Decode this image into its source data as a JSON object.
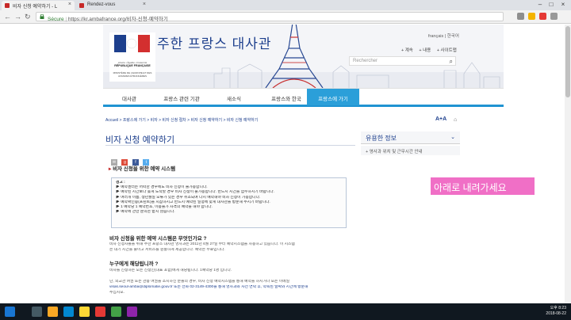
{
  "browser": {
    "tabs": [
      {
        "label": "비자 신청 예약하기 - L"
      },
      {
        "label": "Rendez-vous"
      }
    ],
    "secure_label": "Sécure",
    "url": "https://kr.ambafrance.org/비자-신청-예약하기"
  },
  "header": {
    "site_title": "주한 프랑스 대사관",
    "logo_caption": "Liberté • Égalité • Fraternité",
    "logo_republic": "RÉPUBLIQUE FRANÇAISE",
    "logo_ministry": "MINISTÈRE DE L'EUROPE ET DES AFFAIRES ÉTRANGÈRES",
    "lang_links": "français | 한국어",
    "top_links": [
      "+ 계속",
      "+ 내용",
      "+ 사이트맵"
    ],
    "search_placeholder": "Rechercher"
  },
  "nav": {
    "items": [
      {
        "label": "대사관"
      },
      {
        "label": "프랑스 관련 기관"
      },
      {
        "label": "새소식"
      },
      {
        "label": "프랑스와 한국"
      },
      {
        "label": "프랑스에 가기"
      }
    ]
  },
  "breadcrumb": "Accueil > 프랑스에 가기 > 비자 > 비자 신청 절차 > 비자 신청 예약하기 > 비자 신청 예약하기",
  "font_control": "A+A",
  "main": {
    "title": "비자 신청 예약하기",
    "share_buttons": [
      "mail",
      "g+",
      "f",
      "t"
    ],
    "section_heading": "비자 신청을 위한 예약 시스템",
    "notice_lines": [
      "경고 :",
      "▶ 예약센터는 어떠한 경우에도 비자 신청이 불가능합니다.",
      "▶ 예약된 시간보다 늦게 도착할 경우 비자 신청이 불가능합니다. 반드시 시간을 엄수하시기 바랍니다.",
      "▶ 여러개 이름, 생년월일 오류가 있는 경우 취소되며 다시 예약해야 비자 신청이 가능합니다.",
      "▶ 예약확인증(프린트)을 지참하시고 반드시 예약된 일정에 맞게 대사관을 방문해 주시기 바랍니다.",
      "▶ 1 예약당 1 예약번호, 이용불가 자격의 예약을 해야 합니다.",
      "▶ 예약에 관한 문의는 받지 않습니다."
    ],
    "q1": "비자 신청을 위한 예약 시스템은 무엇인가요 ?",
    "p1": [
      "비자 신청자들을 위해 주한 프랑스 대사관 영사과는 2011년 6월 27일 부터 예약시스템을 사용하고 있습니다. 이 시스템",
      "은 대기 시간을 줄이고 서비스를 원활하게 제공합니다. 예약은 무료입니다."
    ],
    "q2": "누구에게 해당됩니까 ?",
    "p2": [
      "비자를 신청하는 모든 신청인(대표 포함)에게 해당됩니다. 1예약당 1명 입니다.",
      "",
      "단, 외교관 여권 또는 관용 여권을 소지하신 분들의 경우, 비자 신청 예약시스템을 통해 예약을 하시거나 또는 이메일",
      "visas.seoul-amba@diplomatie.gouv.fr 또는 전화 02-3149-4300을 통해 영사과와 사전 연락 후, 약속된 날짜와 시간에 방문해",
      "주십시오."
    ]
  },
  "sidebar": {
    "title": "유용한 정보",
    "link": "+ 영사과 위치 및 근무시간 안내"
  },
  "overlay": "아래로 내려가세요",
  "taskbar": {
    "time": "오후 8:23",
    "date": "2018-08-22"
  }
}
